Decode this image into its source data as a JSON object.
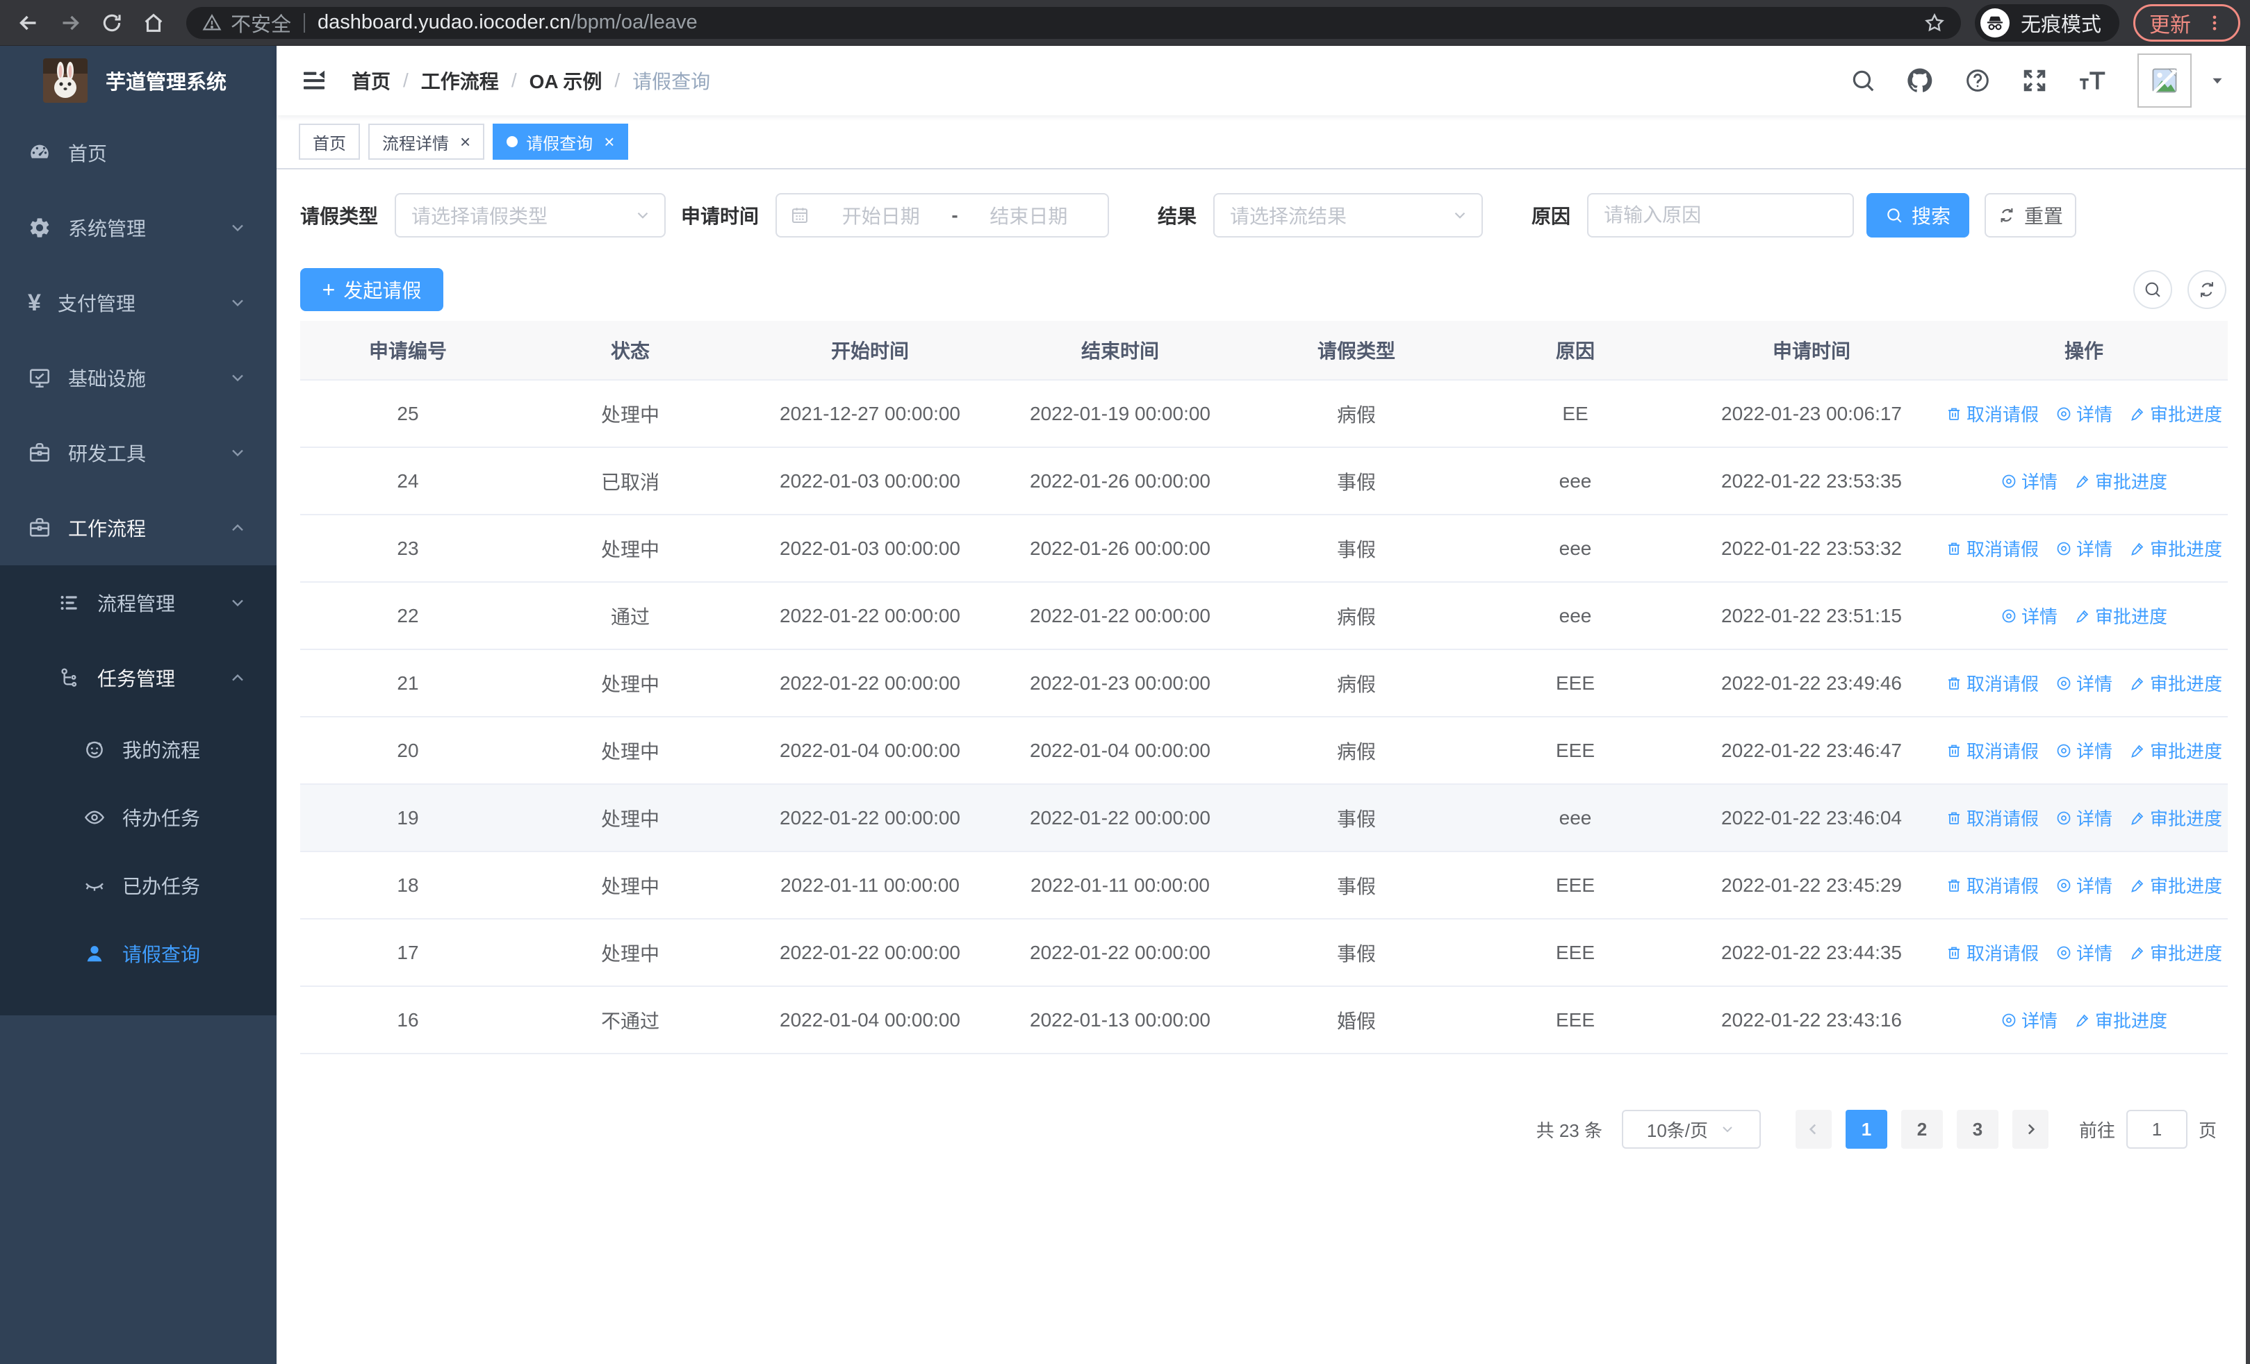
{
  "browser": {
    "security_label": "不安全",
    "url_host": "dashboard.yudao.iocoder.cn",
    "url_path": "/bpm/oa/leave",
    "incognito_label": "无痕模式",
    "update_label": "更新"
  },
  "sidebar": {
    "title": "芋道管理系统",
    "items": [
      {
        "label": "首页",
        "icon": "dashboard-icon",
        "level": 1,
        "chevron": null,
        "active": false,
        "open": false,
        "in_submenu": false
      },
      {
        "label": "系统管理",
        "icon": "gear-icon",
        "level": 1,
        "chevron": "down",
        "active": false,
        "open": false,
        "in_submenu": false
      },
      {
        "label": "支付管理",
        "icon": "yen-icon",
        "level": 1,
        "chevron": "down",
        "active": false,
        "open": false,
        "in_submenu": false
      },
      {
        "label": "基础设施",
        "icon": "monitor-icon",
        "level": 1,
        "chevron": "down",
        "active": false,
        "open": false,
        "in_submenu": false
      },
      {
        "label": "研发工具",
        "icon": "briefcase-icon",
        "level": 1,
        "chevron": "down",
        "active": false,
        "open": false,
        "in_submenu": false
      },
      {
        "label": "工作流程",
        "icon": "workflow-icon",
        "level": 1,
        "chevron": "up",
        "active": false,
        "open": true,
        "in_submenu": false
      },
      {
        "label": "流程管理",
        "icon": "process-list-icon",
        "level": 2,
        "chevron": "down",
        "active": false,
        "open": false,
        "in_submenu": true
      },
      {
        "label": "任务管理",
        "icon": "task-nodes-icon",
        "level": 2,
        "chevron": "up",
        "active": false,
        "open": true,
        "in_submenu": true
      },
      {
        "label": "我的流程",
        "icon": "my-process-icon",
        "level": 3,
        "chevron": null,
        "active": false,
        "open": false,
        "in_submenu": true
      },
      {
        "label": "待办任务",
        "icon": "todo-eye-icon",
        "level": 3,
        "chevron": null,
        "active": false,
        "open": false,
        "in_submenu": true
      },
      {
        "label": "已办任务",
        "icon": "done-eye-icon",
        "level": 3,
        "chevron": null,
        "active": false,
        "open": false,
        "in_submenu": true
      },
      {
        "label": "请假查询",
        "icon": "leave-user-icon",
        "level": 3,
        "chevron": null,
        "active": true,
        "open": false,
        "in_submenu": true
      }
    ]
  },
  "navbar": {
    "breadcrumb": [
      "首页",
      "工作流程",
      "OA 示例",
      "请假查询"
    ]
  },
  "tabs": [
    {
      "label": "首页",
      "closable": false,
      "active": false
    },
    {
      "label": "流程详情",
      "closable": true,
      "active": false
    },
    {
      "label": "请假查询",
      "closable": true,
      "active": true
    }
  ],
  "filters": {
    "type_label": "请假类型",
    "type_placeholder": "请选择请假类型",
    "time_label": "申请时间",
    "start_placeholder": "开始日期",
    "range_separator": "-",
    "end_placeholder": "结束日期",
    "result_label": "结果",
    "result_placeholder": "请选择流结果",
    "reason_label": "原因",
    "reason_placeholder": "请输入原因",
    "search_label": "搜索",
    "reset_label": "重置"
  },
  "toolbar": {
    "create_label": "发起请假"
  },
  "table": {
    "columns": [
      "申请编号",
      "状态",
      "开始时间",
      "结束时间",
      "请假类型",
      "原因",
      "申请时间",
      "操作"
    ],
    "action_labels": {
      "cancel": "取消请假",
      "detail": "详情",
      "progress": "审批进度"
    },
    "rows": [
      {
        "id": "25",
        "status": "处理中",
        "start": "2021-12-27 00:00:00",
        "end": "2022-01-19 00:00:00",
        "type": "病假",
        "reason": "EE",
        "applied": "2022-01-23 00:06:17",
        "actions": [
          "cancel",
          "detail",
          "progress"
        ],
        "highlighted": false
      },
      {
        "id": "24",
        "status": "已取消",
        "start": "2022-01-03 00:00:00",
        "end": "2022-01-26 00:00:00",
        "type": "事假",
        "reason": "eee",
        "applied": "2022-01-22 23:53:35",
        "actions": [
          "detail",
          "progress"
        ],
        "highlighted": false
      },
      {
        "id": "23",
        "status": "处理中",
        "start": "2022-01-03 00:00:00",
        "end": "2022-01-26 00:00:00",
        "type": "事假",
        "reason": "eee",
        "applied": "2022-01-22 23:53:32",
        "actions": [
          "cancel",
          "detail",
          "progress"
        ],
        "highlighted": false
      },
      {
        "id": "22",
        "status": "通过",
        "start": "2022-01-22 00:00:00",
        "end": "2022-01-22 00:00:00",
        "type": "病假",
        "reason": "eee",
        "applied": "2022-01-22 23:51:15",
        "actions": [
          "detail",
          "progress"
        ],
        "highlighted": false
      },
      {
        "id": "21",
        "status": "处理中",
        "start": "2022-01-22 00:00:00",
        "end": "2022-01-23 00:00:00",
        "type": "病假",
        "reason": "EEE",
        "applied": "2022-01-22 23:49:46",
        "actions": [
          "cancel",
          "detail",
          "progress"
        ],
        "highlighted": false
      },
      {
        "id": "20",
        "status": "处理中",
        "start": "2022-01-04 00:00:00",
        "end": "2022-01-04 00:00:00",
        "type": "病假",
        "reason": "EEE",
        "applied": "2022-01-22 23:46:47",
        "actions": [
          "cancel",
          "detail",
          "progress"
        ],
        "highlighted": false
      },
      {
        "id": "19",
        "status": "处理中",
        "start": "2022-01-22 00:00:00",
        "end": "2022-01-22 00:00:00",
        "type": "事假",
        "reason": "eee",
        "applied": "2022-01-22 23:46:04",
        "actions": [
          "cancel",
          "detail",
          "progress"
        ],
        "highlighted": true
      },
      {
        "id": "18",
        "status": "处理中",
        "start": "2022-01-11 00:00:00",
        "end": "2022-01-11 00:00:00",
        "type": "事假",
        "reason": "EEE",
        "applied": "2022-01-22 23:45:29",
        "actions": [
          "cancel",
          "detail",
          "progress"
        ],
        "highlighted": false
      },
      {
        "id": "17",
        "status": "处理中",
        "start": "2022-01-22 00:00:00",
        "end": "2022-01-22 00:00:00",
        "type": "事假",
        "reason": "EEE",
        "applied": "2022-01-22 23:44:35",
        "actions": [
          "cancel",
          "detail",
          "progress"
        ],
        "highlighted": false
      },
      {
        "id": "16",
        "status": "不通过",
        "start": "2022-01-04 00:00:00",
        "end": "2022-01-13 00:00:00",
        "type": "婚假",
        "reason": "EEE",
        "applied": "2022-01-22 23:43:16",
        "actions": [
          "detail",
          "progress"
        ],
        "highlighted": false
      }
    ]
  },
  "pagination": {
    "total": "共 23 条",
    "page_size": "10条/页",
    "pages": [
      "1",
      "2",
      "3"
    ],
    "active_page": "1",
    "goto_label": "前往",
    "goto_value": "1",
    "goto_suffix": "页"
  },
  "colors": {
    "primary": "#409EFF",
    "sidebar_bg": "#304156",
    "submenu_bg": "#1f2d3d",
    "sidebar_text": "#bfcbd9",
    "update_accent": "#f28b82"
  }
}
